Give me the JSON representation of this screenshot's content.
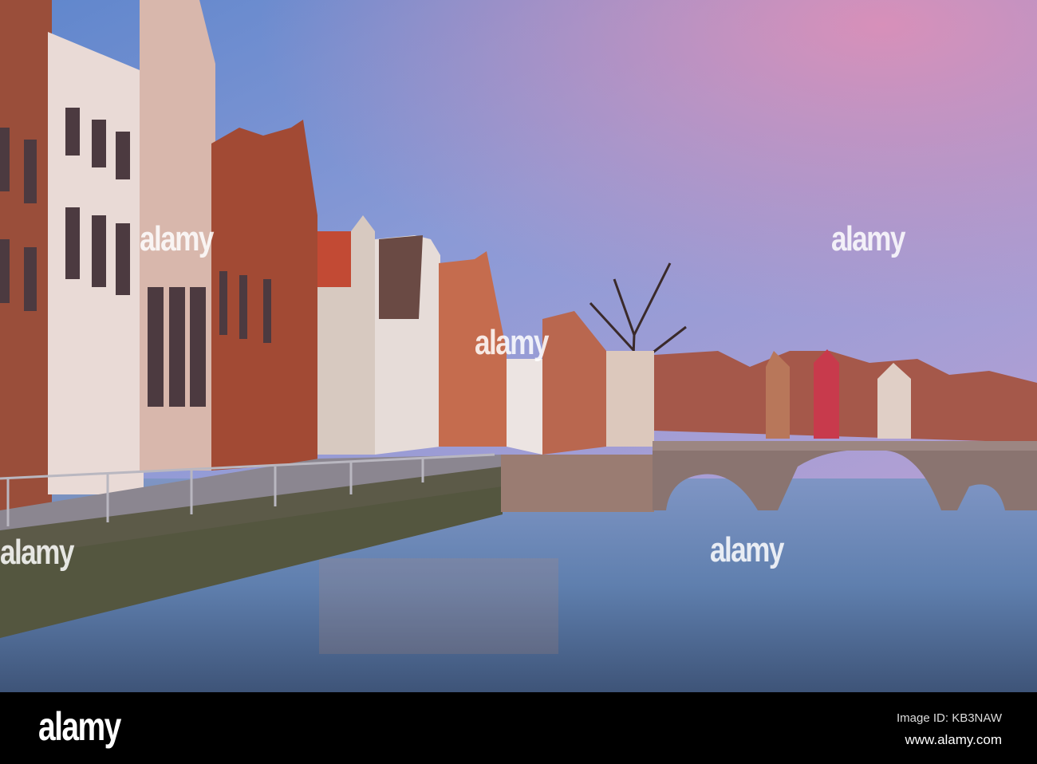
{
  "photo": {
    "subject": "canal-with-bridge-and-gabled-houses",
    "colors": {
      "sky_top": "#6f8fd0",
      "sky_pink": "#d68fb8",
      "water": "#6f8fb8",
      "brick": "#a4513c"
    }
  },
  "watermark": {
    "text": "alamy"
  },
  "footer": {
    "logo": "alamy",
    "image_id": "Image ID: KB3NAW",
    "url": "www.alamy.com"
  }
}
